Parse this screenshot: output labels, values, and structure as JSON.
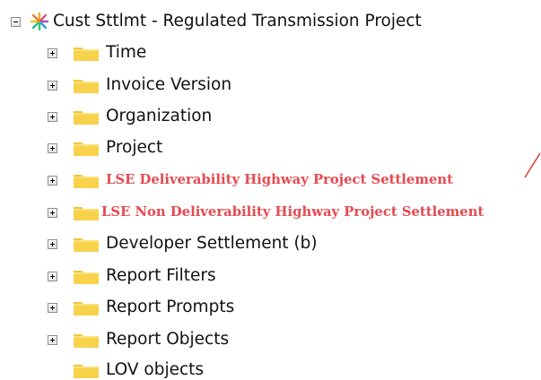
{
  "tree": {
    "root": {
      "label": "Cust Sttlmt - Regulated Transmission Project",
      "state": "expanded",
      "icon": "project-star-icon"
    },
    "children": [
      {
        "label": "Time",
        "state": "collapsed",
        "highlight": false
      },
      {
        "label": "Invoice Version",
        "state": "collapsed",
        "highlight": false
      },
      {
        "label": "Organization",
        "state": "collapsed",
        "highlight": false
      },
      {
        "label": "Project",
        "state": "collapsed",
        "highlight": false
      },
      {
        "label": "LSE Deliverability Highway Project Settlement",
        "state": "collapsed",
        "highlight": true
      },
      {
        "label": "LSE Non Deliverability Highway Project Settlement",
        "state": "collapsed",
        "highlight": true
      },
      {
        "label": "Developer Settlement (b)",
        "state": "collapsed",
        "highlight": false
      },
      {
        "label": "Report Filters",
        "state": "collapsed",
        "highlight": false
      },
      {
        "label": "Report Prompts",
        "state": "collapsed",
        "highlight": false
      },
      {
        "label": "Report Objects",
        "state": "collapsed",
        "highlight": false
      },
      {
        "label": "LOV objects",
        "state": "leaf",
        "highlight": false
      }
    ]
  },
  "colors": {
    "highlight_text": "#e64a50",
    "folder_fill": "#f7d24a",
    "folder_tab": "#f2c53a",
    "text": "#111111"
  }
}
